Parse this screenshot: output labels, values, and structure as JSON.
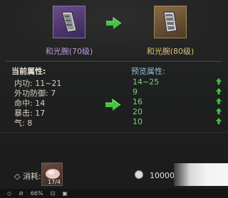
{
  "current_item": {
    "name": "和光腕(70级)"
  },
  "upgraded_item": {
    "name": "和光腕(80级)"
  },
  "current_attributes": {
    "title": "当前属性:",
    "rows": [
      {
        "label": "内功: ",
        "value": "11~21"
      },
      {
        "label": "外功防御: ",
        "value": "7"
      },
      {
        "label": "命中: ",
        "value": "14"
      },
      {
        "label": "暴击: ",
        "value": "17"
      },
      {
        "label": "气: ",
        "value": "8"
      }
    ]
  },
  "preview_attributes": {
    "title": "预览属性:",
    "values": [
      "14~25",
      "9",
      "16",
      "20",
      "10"
    ]
  },
  "cost": {
    "label": "消耗:",
    "item_count": "17/4",
    "money": "10000"
  },
  "status": {
    "zoom": "66%"
  },
  "colors": {
    "increase": "#43c443",
    "preview_title": "#8fc0d8",
    "purple_item": "#b99ce0",
    "gold_item": "#e0c07a"
  }
}
